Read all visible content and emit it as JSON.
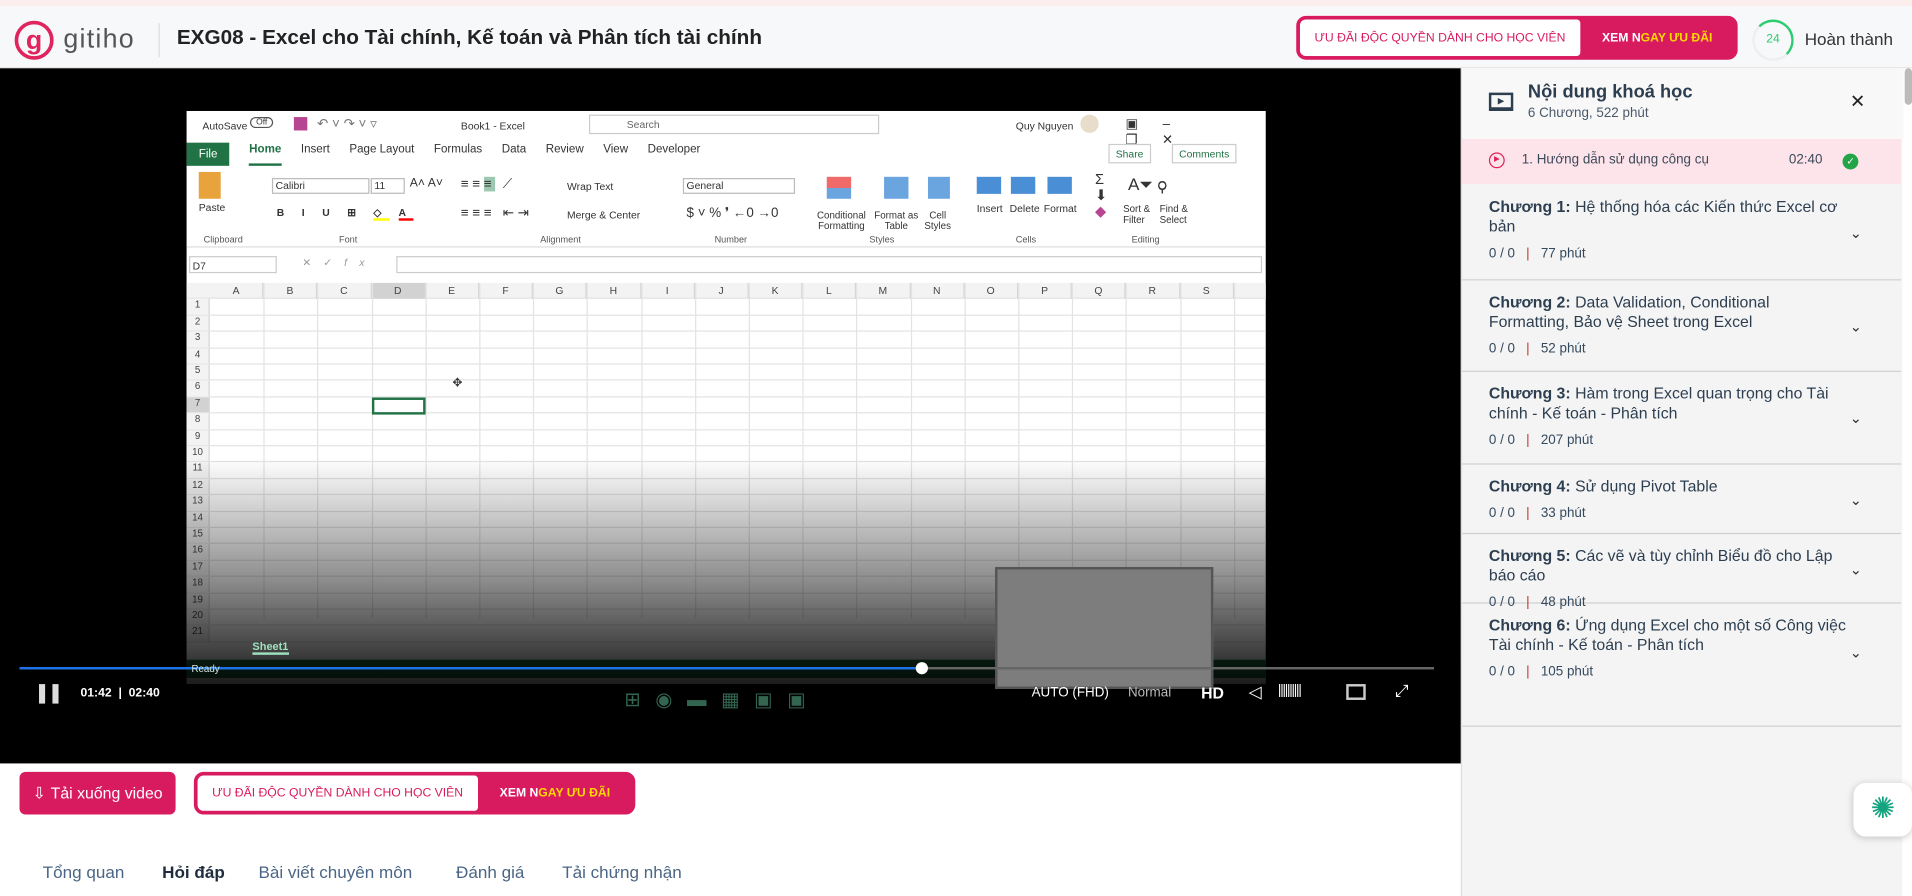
{
  "header": {
    "logo_letter": "g",
    "logo_text": "gitiho",
    "course_title": "EXG08 - Excel cho Tài chính, Kế toán và Phân tích tài chính",
    "promo_left": "ƯU ĐÃI ĐỘC QUYỀN DÀNH CHO HỌC VIÊN",
    "promo_right_a": "XEM N",
    "promo_right_b": "GAY ƯU ĐÃI",
    "progress_value": "24",
    "progress_label": "Hoàn thành"
  },
  "excel": {
    "autosave": "AutoSave",
    "autosave_state": "Off",
    "book_title": "Book1  -  Excel",
    "search_placeholder": "Search",
    "user": "Quy Nguyen",
    "tabs": [
      "File",
      "Home",
      "Insert",
      "Page Layout",
      "Formulas",
      "Data",
      "Review",
      "View",
      "Developer"
    ],
    "share": "Share",
    "comments": "Comments",
    "ribbon": {
      "paste": "Paste",
      "font": "Calibri",
      "size": "11",
      "wrap": "Wrap Text",
      "merge": "Merge & Center",
      "number_format": "General",
      "cond": "Conditional Formatting",
      "fmt_table": "Format as Table",
      "cell_styles": "Cell Styles",
      "insert": "Insert",
      "delete": "Delete",
      "format": "Format",
      "sort": "Sort & Filter",
      "find": "Find & Select"
    },
    "groups": [
      "Clipboard",
      "Font",
      "Alignment",
      "Number",
      "Styles",
      "Cells",
      "Editing"
    ],
    "name_box": "D7",
    "fx": "fx",
    "columns": [
      "A",
      "B",
      "C",
      "D",
      "E",
      "F",
      "G",
      "H",
      "I",
      "J",
      "K",
      "L",
      "M",
      "N",
      "O",
      "P",
      "Q",
      "R",
      "S"
    ],
    "rows": 21,
    "selected_cell": "D7",
    "sheet_tab": "Sheet1",
    "status": "Ready"
  },
  "player": {
    "current_time": "01:42",
    "duration": "02:40",
    "progress_fraction": 0.638,
    "quality": "AUTO (FHD)",
    "speed": "Normal",
    "hd": "HD"
  },
  "actions": {
    "download": "Tải xuống video",
    "promo_left": "ƯU ĐÃI ĐỘC QUYỀN DÀNH CHO HỌC VIÊN",
    "promo_right_a": "XEM N",
    "promo_right_b": "GAY ƯU ĐÃI"
  },
  "tabs": [
    "Tổng quan",
    "Hỏi đáp",
    "Bài viết chuyên môn",
    "Đánh giá",
    "Tải chứng nhận"
  ],
  "sidebar": {
    "title": "Nội dung khoá học",
    "subtitle": "6 Chương, 522 phút",
    "current_lesson": "1. Hướng dẫn sử dụng công cụ",
    "current_duration": "02:40",
    "chapters": [
      {
        "label": "Chương 1:",
        "title": "Hệ thống hóa các Kiến thức Excel cơ bản",
        "progress": "0 / 0",
        "duration": "77 phút"
      },
      {
        "label": "Chương 2:",
        "title": "Data Validation, Conditional Formatting, Bảo vệ Sheet trong Excel",
        "progress": "0 / 0",
        "duration": "52 phút"
      },
      {
        "label": "Chương 3:",
        "title": "Hàm trong Excel quan trọng cho Tài chính - Kế toán - Phân tích",
        "progress": "0 / 0",
        "duration": "207 phút"
      },
      {
        "label": "Chương 4:",
        "title": "Sử dụng Pivot Table",
        "progress": "0 / 0",
        "duration": "33 phút"
      },
      {
        "label": "Chương 5:",
        "title": "Các vẽ và tùy chỉnh Biểu đồ cho Lập báo cáo",
        "progress": "0 / 0",
        "duration": "48 phút"
      },
      {
        "label": "Chương 6:",
        "title": "Ứng dụng Excel cho một số Công việc Tài chính - Kế toán - Phân tích",
        "progress": "0 / 0",
        "duration": "105 phút"
      }
    ]
  },
  "colors": {
    "brand": "#d81b5f",
    "accent_yellow": "#ffd800",
    "excel_green": "#217346",
    "complete_green": "#2ecc71"
  }
}
